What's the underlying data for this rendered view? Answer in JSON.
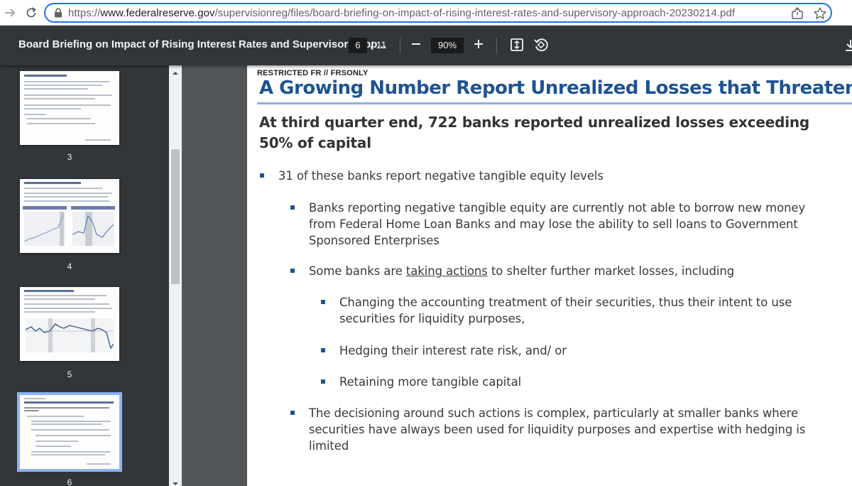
{
  "browser": {
    "url_prefix": "https://",
    "url_host": "www.federalreserve.gov",
    "url_path": "/supervisionreg/files/board-briefing-on-impact-of-rising-interest-rates-and-supervisory-approach-20230214.pdf"
  },
  "pdf_toolbar": {
    "title": "Board Briefing on Impact of Rising Interest Rates and Supervisory App...",
    "current_page": "6",
    "total_pages": "/ 11",
    "zoom": "90%"
  },
  "sidebar": {
    "pages": [
      {
        "number": "3"
      },
      {
        "number": "4"
      },
      {
        "number": "5"
      },
      {
        "number": "6"
      }
    ]
  },
  "slide": {
    "classification": "RESTRICTED FR // FRSONLY",
    "title": "A Growing Number Report Unrealized Losses that Threaten Capital",
    "subtitle": "At third quarter end, 722 banks reported unrealized losses exceeding 50% of capital",
    "bullets": {
      "b1": "31 of these banks report negative tangible equity levels",
      "b1_1": "Banks reporting negative tangible equity are currently not able to borrow new money from Federal Home Loan Banks and may lose the ability to sell loans to Government Sponsored Enterprises",
      "b1_2_pre": "Some banks are ",
      "b1_2_link": "taking actions",
      "b1_2_post": " to shelter further market losses, including",
      "b1_2_1": "Changing the accounting treatment of their securities, thus their intent to use securities for liquidity purposes,",
      "b1_2_2": "Hedging their interest rate risk, and/ or",
      "b1_2_3": "Retaining more tangible capital",
      "b1_3": "The decisioning around such actions is complex, particularly at smaller banks where securities have always been used for liquidity purposes and expertise with hedging is limited"
    }
  },
  "colors": {
    "title_blue": "#1f5391",
    "toolbar_bg": "#323639",
    "viewer_bg": "#525659"
  }
}
